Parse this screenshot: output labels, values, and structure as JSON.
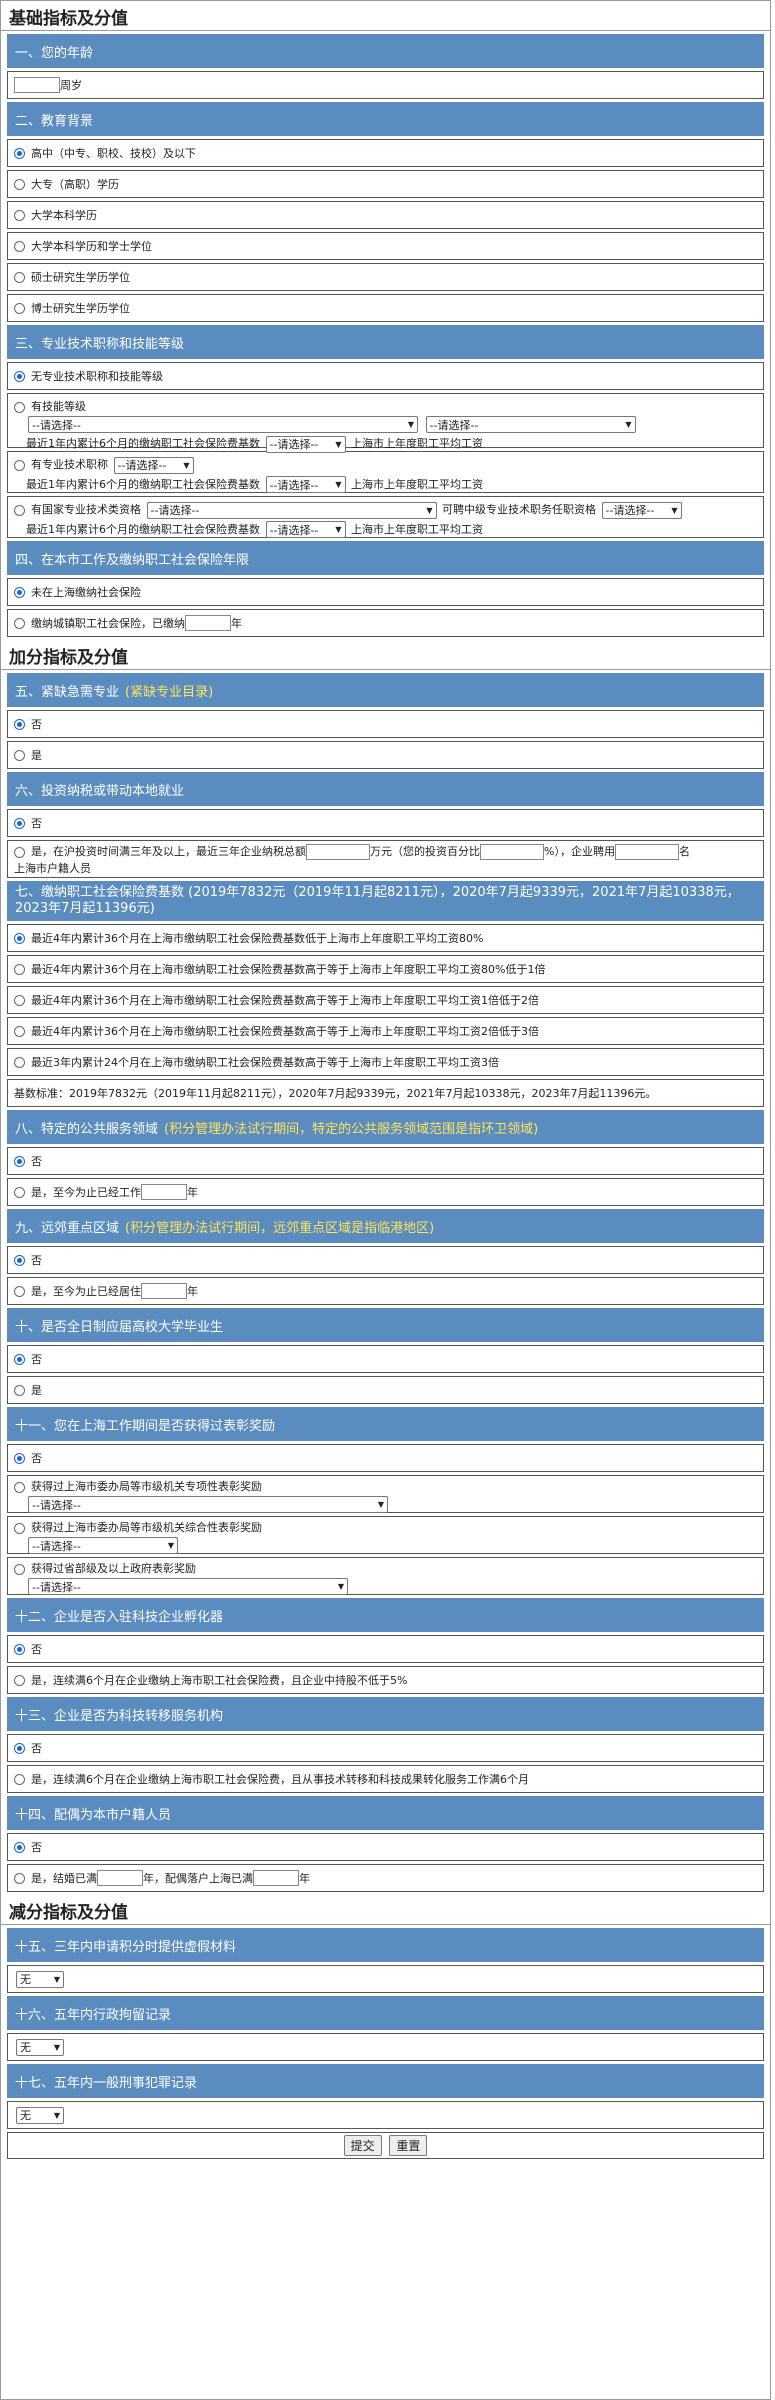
{
  "basic": {
    "title": "基础指标及分值",
    "age": {
      "header": "一、您的年龄",
      "unit": "周岁"
    },
    "edu": {
      "header": "二、教育背景",
      "options": [
        "高中（中专、职校、技校）及以下",
        "大专（高职）学历",
        "大学本科学历",
        "大学本科学历和学士学位",
        "硕士研究生学历学位",
        "博士研究生学历学位"
      ]
    },
    "title3": {
      "header": "三、专业技术职称和技能等级",
      "none": "无专业技术职称和技能等级",
      "skill": "有技能等级",
      "select_placeholder": "--请选择--",
      "skill_note_pre": "最近1年内累计6个月的缴纳职工社会保险费基数",
      "skill_note_post": "上海市上年度职工平均工资",
      "prof": "有专业技术职称",
      "cert": "有国家专业技术类资格",
      "cert_mid": "可聘中级专业技术职务任职资格"
    },
    "ins": {
      "header": "四、在本市工作及缴纳职工社会保险年限",
      "none": "未在上海缴纳社会保险",
      "paid_pre": "缴纳城镇职工社会保险，已缴纳",
      "paid_unit": "年"
    }
  },
  "bonus": {
    "title": "加分指标及分值",
    "s5": {
      "header": "五、紧缺急需专业",
      "hl": "(紧缺专业目录)",
      "no": "否",
      "yes": "是"
    },
    "s6": {
      "header": "六、投资纳税或带动本地就业",
      "no": "否",
      "yes_a": "是，在沪投资时间满三年及以上，最近三年企业纳税总额",
      "yes_b": "万元（您的投资百分比",
      "yes_c": "%），企业聘用",
      "yes_d": "名",
      "yes_e": "上海市户籍人员"
    },
    "s7": {
      "header": "七、缴纳职工社会保险费基数 (2019年7832元（2019年11月起8211元），2020年7月起9339元，2021年7月起10338元，2023年7月起11396元)",
      "options": [
        "最近4年内累计36个月在上海市缴纳职工社会保险费基数低于上海市上年度职工平均工资80%",
        "最近4年内累计36个月在上海市缴纳职工社会保险费基数高于等于上海市上年度职工平均工资80%低于1倍",
        "最近4年内累计36个月在上海市缴纳职工社会保险费基数高于等于上海市上年度职工平均工资1倍低于2倍",
        "最近4年内累计36个月在上海市缴纳职工社会保险费基数高于等于上海市上年度职工平均工资2倍低于3倍",
        "最近3年内累计24个月在上海市缴纳职工社会保险费基数高于等于上海市上年度职工平均工资3倍"
      ],
      "note": "基数标准：2019年7832元（2019年11月起8211元），2020年7月起9339元，2021年7月起10338元，2023年7月起11396元。"
    },
    "s8": {
      "header": "八、特定的公共服务领域",
      "hl": "(积分管理办法试行期间，特定的公共服务领域范围是指环卫领域)",
      "no": "否",
      "yes": "是，至今为止已经工作",
      "unit": "年"
    },
    "s9": {
      "header": "九、远郊重点区域",
      "hl": "(积分管理办法试行期间，远郊重点区域是指临港地区)",
      "no": "否",
      "yes": "是，至今为止已经居住",
      "unit": "年"
    },
    "s10": {
      "header": "十、是否全日制应届高校大学毕业生",
      "no": "否",
      "yes": "是"
    },
    "s11": {
      "header": "十一、您在上海工作期间是否获得过表彰奖励",
      "no": "否",
      "opt1": "获得过上海市委办局等市级机关专项性表彰奖励",
      "opt2": "获得过上海市委办局等市级机关综合性表彰奖励",
      "opt3": "获得过省部级及以上政府表彰奖励",
      "placeholder": "--请选择--"
    },
    "s12": {
      "header": "十二、企业是否入驻科技企业孵化器",
      "no": "否",
      "yes": "是，连续满6个月在企业缴纳上海市职工社会保险费，且企业中持股不低于5%"
    },
    "s13": {
      "header": "十三、企业是否为科技转移服务机构",
      "no": "否",
      "yes": "是，连续满6个月在企业缴纳上海市职工社会保险费，且从事技术转移和科技成果转化服务工作满6个月"
    },
    "s14": {
      "header": "十四、配偶为本市户籍人员",
      "no": "否",
      "yes_a": "是，结婚已满",
      "yes_b": "年，配偶落户上海已满",
      "yes_c": "年"
    }
  },
  "minus": {
    "title": "减分指标及分值",
    "s15": {
      "header": "十五、三年内申请积分时提供虚假材料",
      "value": "无"
    },
    "s16": {
      "header": "十六、五年内行政拘留记录",
      "value": "无"
    },
    "s17": {
      "header": "十七、五年内一般刑事犯罪记录",
      "value": "无"
    }
  },
  "buttons": {
    "submit": "提交",
    "reset": "重置"
  }
}
